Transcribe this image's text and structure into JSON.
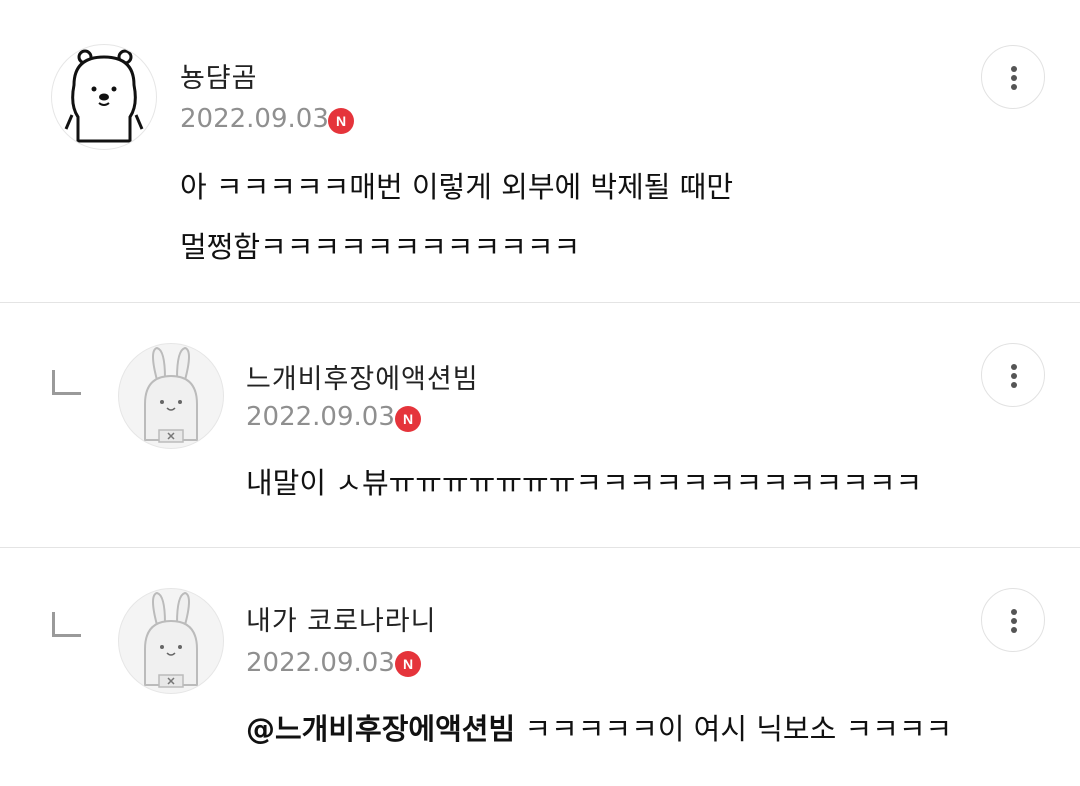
{
  "comments": [
    {
      "nickname": "뇽댬곰",
      "date": "2022.09.03",
      "badge": "N",
      "text": "아 ㅋㅋㅋㅋㅋ매번 이렇게 외부에 박제될 때만\n멀쩡함ㅋㅋㅋㅋㅋㅋㅋㅋㅋㅋㅋㅋ",
      "avatar_icon": "bear-avatar-icon",
      "is_reply": false
    },
    {
      "nickname": "느개비후장에액션빔",
      "date": "2022.09.03",
      "badge": "N",
      "text": "내말이 ㅅ뷰ㅠㅠㅠㅠㅠㅠㅠㅋㅋㅋㅋㅋㅋㅋㅋㅋㅋㅋㅋㅋ",
      "avatar_icon": "rabbit-avatar-icon",
      "is_reply": true
    },
    {
      "nickname": "내가 코로나라니",
      "date": "2022.09.03",
      "badge": "N",
      "mention": "@느개비후장에액션빔",
      "text": " ㅋㅋㅋㅋㅋ이 여시 닉보소 ㅋㅋㅋㅋ",
      "avatar_icon": "rabbit-avatar-icon",
      "is_reply": true
    }
  ],
  "colors": {
    "badge": "#e5343b",
    "date": "#8f8f8f",
    "divider": "#e4e4e4"
  }
}
